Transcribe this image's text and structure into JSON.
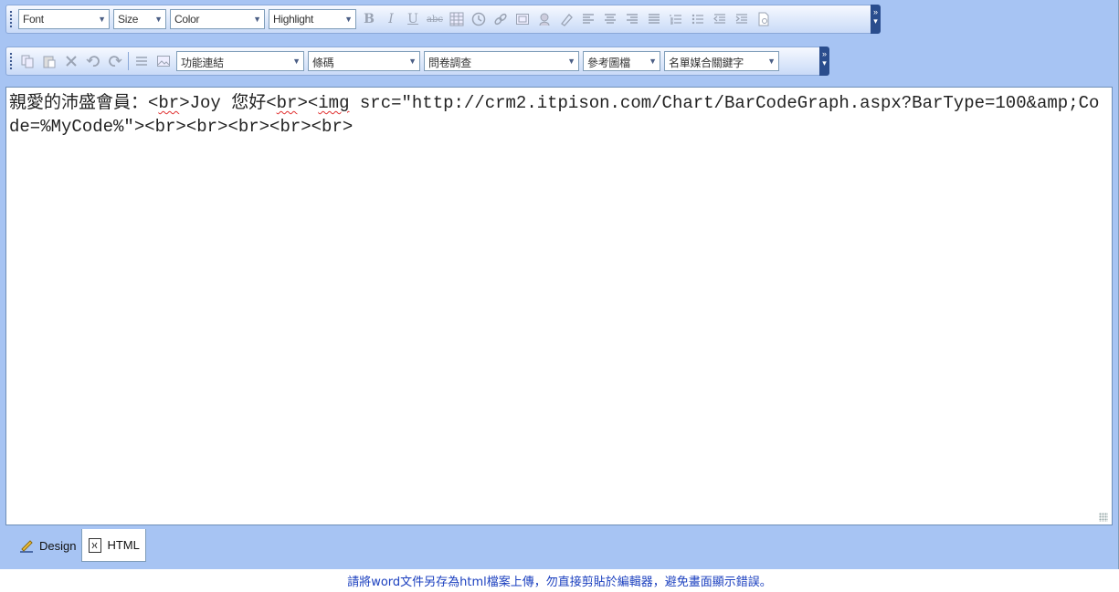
{
  "toolbar1": {
    "font_label": "Font",
    "size_label": "Size",
    "color_label": "Color",
    "highlight_label": "Highlight",
    "bold": "B",
    "italic": "I",
    "underline": "U",
    "strike": "abc"
  },
  "toolbar2": {
    "feature_link": "功能連結",
    "barcode": "條碼",
    "survey": "問卷調查",
    "reference_file": "參考圖檔",
    "merge_keyword": "名單媒合關鍵字"
  },
  "content": {
    "p1": "親愛的沛盛會員：<",
    "br1": "br",
    "p2": ">Joy 您好<",
    "br2": "br",
    "p3": "><",
    "img": "img",
    "p4": " src=\"http://crm2.itpison.com/Chart/BarCodeGraph.aspx?BarType=100&amp;Code=%MyCode%\"><br><br><br><br><br>"
  },
  "tabs": {
    "design": "Design",
    "html": "HTML"
  },
  "footer_note": "請將word文件另存為html檔案上傳，勿直接剪貼於編輯器，避免畫面顯示錯誤。",
  "colors": {
    "toolbar_bg": "#a7c4f3",
    "note_text": "#1a3fbf"
  }
}
